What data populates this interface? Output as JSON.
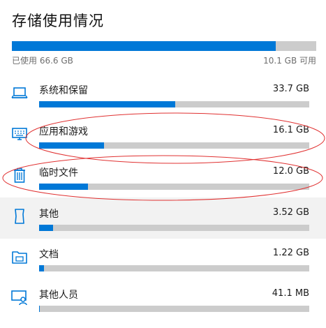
{
  "title": "存储使用情况",
  "total": {
    "used_label": "已使用 66.6 GB",
    "free_label": "10.1 GB 可用",
    "used_fraction": 0.868
  },
  "categories": [
    {
      "name": "系统和保留",
      "size": "33.7 GB",
      "fraction": 0.505,
      "icon": "laptop-icon",
      "highlighted": false
    },
    {
      "name": "应用和游戏",
      "size": "16.1 GB",
      "fraction": 0.24,
      "icon": "keyboard-monitor-icon",
      "highlighted": false
    },
    {
      "name": "临时文件",
      "size": "12.0 GB",
      "fraction": 0.18,
      "icon": "trash-icon",
      "highlighted": false
    },
    {
      "name": "其他",
      "size": "3.52 GB",
      "fraction": 0.052,
      "icon": "document-icon",
      "highlighted": true
    },
    {
      "name": "文档",
      "size": "1.22 GB",
      "fraction": 0.018,
      "icon": "folder-icon",
      "highlighted": false
    },
    {
      "name": "其他人员",
      "size": "41.1 MB",
      "fraction": 0.002,
      "icon": "person-monitor-icon",
      "highlighted": false
    }
  ],
  "colors": {
    "accent": "#0078d7",
    "track": "#cccccc",
    "annotation": "#e03030",
    "highlight_row": "#f2f2f2"
  }
}
